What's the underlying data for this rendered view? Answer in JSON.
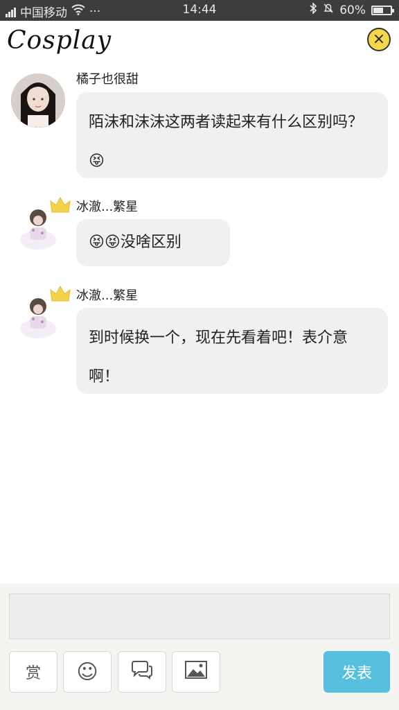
{
  "status_bar": {
    "carrier": "中国移动",
    "dots": "···",
    "time": "14:44",
    "battery": "60%",
    "battery_level": 0.6
  },
  "header": {
    "title": "Cosplay",
    "close_icon": "×"
  },
  "messages": [
    {
      "author": "橘子也很甜",
      "text": "陌沫和沫沫这两者读起来有什么区别吗？😝"
    },
    {
      "author": "冰澈...繁星",
      "text": "😝😝没啥区别"
    },
    {
      "author": "冰澈...繁星",
      "text": "到时候换一个，现在先看着吧！表介意啊！"
    }
  ],
  "composer": {
    "reward_label": "赏",
    "emoji_icon": "☺",
    "send_label": "发表"
  },
  "colors": {
    "status_bg": "#3d3d3d",
    "bubble_bg": "#f0f0f0",
    "send_bg": "#58c0df",
    "close_bg": "#f6d74a"
  }
}
